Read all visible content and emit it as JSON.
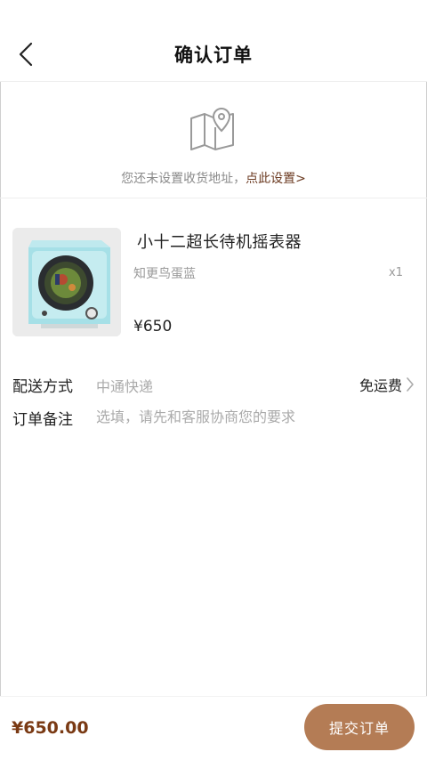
{
  "header": {
    "title": "确认订单",
    "back_icon": "chevron-left-icon"
  },
  "address": {
    "icon": "map-pin-icon",
    "hint": "您还未设置收货地址，",
    "link": "点此设置>"
  },
  "product": {
    "name": "小十二超长待机摇表器",
    "variant": "知更鸟蛋蓝",
    "quantity": "x1",
    "price": "¥650"
  },
  "delivery": {
    "label": "配送方式",
    "method": "中通快递",
    "fee": "免运费",
    "arrow_icon": "chevron-right-icon"
  },
  "remark": {
    "label": "订单备注",
    "placeholder": "选填，请先和客服协商您的要求",
    "value": ""
  },
  "footer": {
    "total": "¥650.00",
    "submit_label": "提交订单"
  },
  "colors": {
    "accent": "#b47c55",
    "price": "#7a3a14",
    "link": "#6b3a21"
  }
}
